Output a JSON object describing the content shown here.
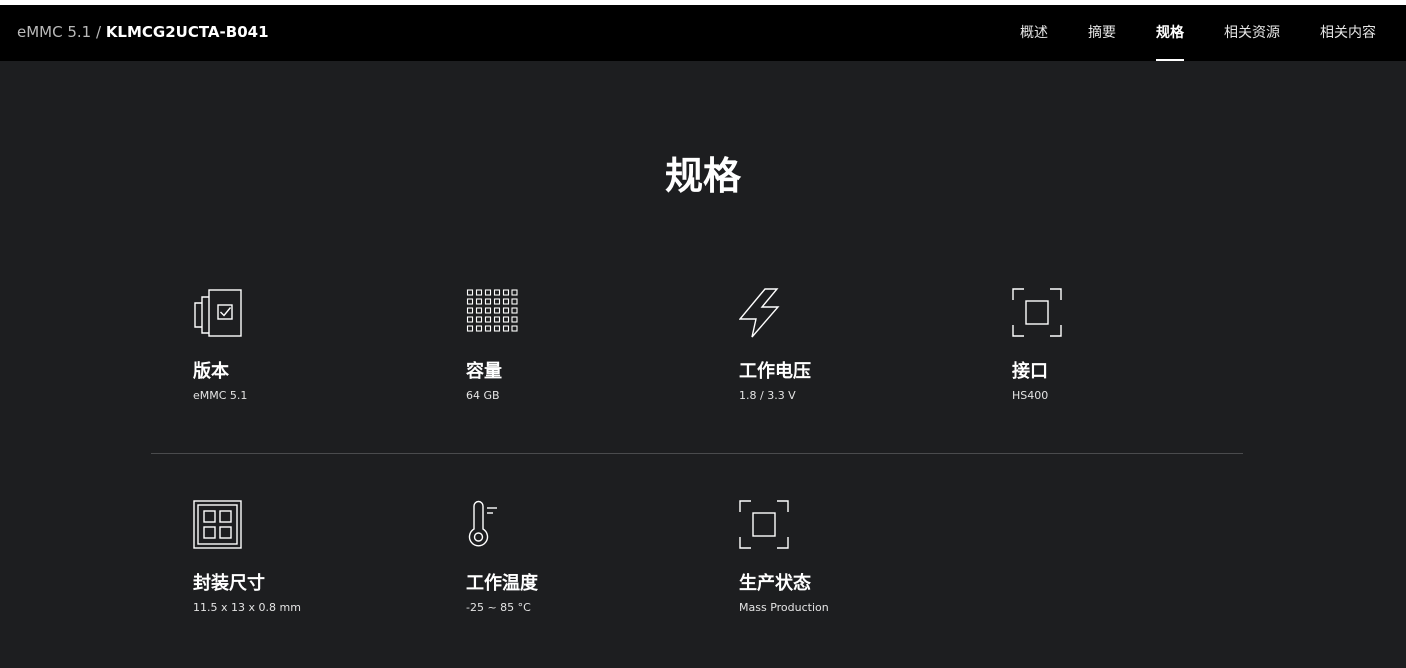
{
  "header": {
    "breadcrumb_parent": "eMMC 5.1",
    "breadcrumb_separator": " / ",
    "breadcrumb_current": "KLMCG2UCTA-B041",
    "tabs": [
      {
        "label": "概述"
      },
      {
        "label": "摘要"
      },
      {
        "label": "规格",
        "active": true
      },
      {
        "label": "相关资源"
      },
      {
        "label": "相关内容"
      }
    ]
  },
  "page_title": "规格",
  "specs": [
    {
      "label": "版本",
      "value": "eMMC 5.1",
      "icon": "version-icon"
    },
    {
      "label": "容量",
      "value": "64 GB",
      "icon": "capacity-grid-icon"
    },
    {
      "label": "工作电压",
      "value": "1.8 / 3.3 V",
      "icon": "lightning-icon"
    },
    {
      "label": "接口",
      "value": "HS400",
      "icon": "interface-frame-icon"
    },
    {
      "label": "封装尺寸",
      "value": "11.5 x 13 x 0.8 mm",
      "icon": "package-icon"
    },
    {
      "label": "工作温度",
      "value": "-25 ~ 85 °C",
      "icon": "thermometer-icon"
    },
    {
      "label": "生产状态",
      "value": "Mass Production",
      "icon": "status-frame-icon"
    }
  ],
  "colors": {
    "background": "#1d1e20",
    "navbar": "#000000",
    "text": "#ffffff",
    "divider": "#4a4b4d"
  }
}
